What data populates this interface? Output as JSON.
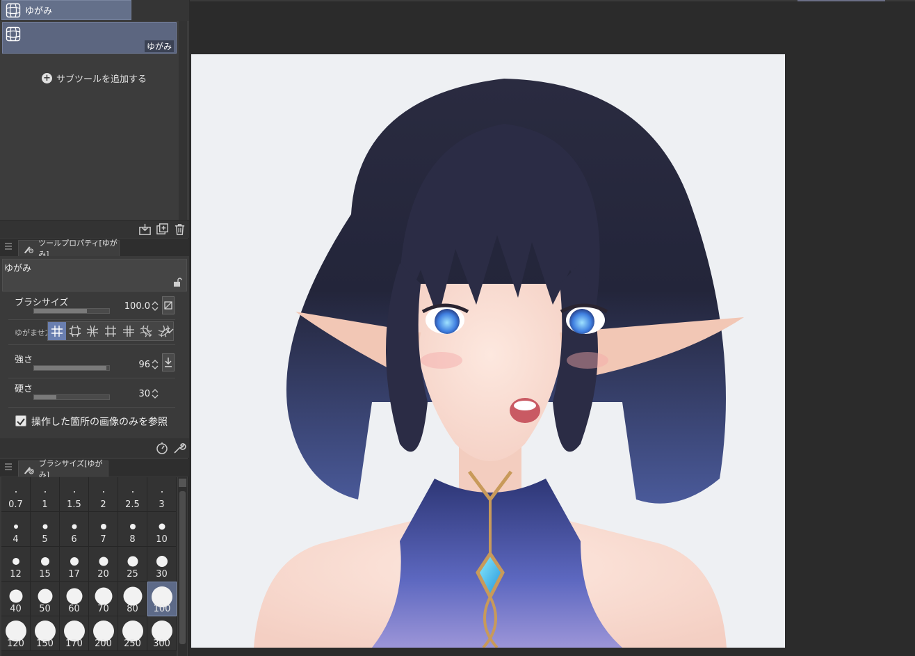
{
  "subtool": {
    "group_tab_label": "ゆがみ",
    "item_label": "ゆがみ",
    "add_label": "サブツールを追加する"
  },
  "tool_property": {
    "tab_label": "ツールプロパティ[ゆがみ]",
    "tool_name": "ゆがみ",
    "brush_size_label": "ブラシサイズ",
    "brush_size_value": "100.0",
    "brush_size_fraction": 0.7,
    "warp_mode_label": "ゆがませ方",
    "strength_label": "強さ",
    "strength_value": "96",
    "strength_fraction": 0.96,
    "hardness_label": "硬さ",
    "hardness_value": "30",
    "hardness_fraction": 0.3,
    "refer_label": "操作した箇所の画像のみを参照",
    "refer_checked": true
  },
  "brush_size_palette": {
    "tab_label": "ブラシサイズ[ゆがみ]",
    "sizes": [
      "0.7",
      "1",
      "1.5",
      "2",
      "2.5",
      "3",
      "4",
      "5",
      "6",
      "7",
      "8",
      "10",
      "12",
      "15",
      "17",
      "20",
      "25",
      "30",
      "40",
      "50",
      "60",
      "70",
      "80",
      "100",
      "120",
      "150",
      "170",
      "200",
      "250",
      "300"
    ],
    "selected": "100"
  },
  "colors": {
    "accent": "#6a7fb0",
    "selected_cell": "#5d6a88",
    "panel_bg": "#3a3a3a"
  }
}
